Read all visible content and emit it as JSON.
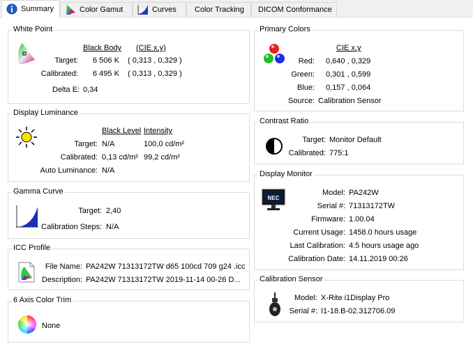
{
  "tabs": [
    {
      "label": "Summary",
      "icon": "info-icon",
      "active": true
    },
    {
      "label": "Color Gamut",
      "icon": "color-gamut-icon",
      "active": false
    },
    {
      "label": "Curves",
      "icon": "curves-icon",
      "active": false
    },
    {
      "label": "Color Tracking",
      "icon": "",
      "active": false
    },
    {
      "label": "DICOM Conformance",
      "icon": "",
      "active": false
    }
  ],
  "white_point": {
    "title": "White Point",
    "col_black_body": "Black Body",
    "col_cie": "(CIE x,y)",
    "target_label": "Target:",
    "target_bb": "6 506 K",
    "target_cie": "( 0,313 , 0,329 )",
    "calibrated_label": "Calibrated:",
    "calibrated_bb": "6 495 K",
    "calibrated_cie": "( 0,313 , 0,329 )",
    "delta_label": "Delta E:",
    "delta_value": "0,34"
  },
  "display_luminance": {
    "title": "Display Luminance",
    "col_black": "Black Level",
    "col_intensity": "Intensity",
    "target_label": "Target:",
    "target_black": "N/A",
    "target_intensity": "100,0 cd/m²",
    "calibrated_label": "Calibrated:",
    "calibrated_black": "0,13 cd/m²",
    "calibrated_intensity": "99,2 cd/m²",
    "auto_label": "Auto Luminance:",
    "auto_value": "N/A"
  },
  "gamma_curve": {
    "title": "Gamma Curve",
    "target_label": "Target:",
    "target_value": "2,40",
    "steps_label": "Calibration Steps:",
    "steps_value": "N/A"
  },
  "icc_profile": {
    "title": "ICC Profile",
    "file_label": "File Name:",
    "file_value": "PA242W 71313172TW d65 100cd 709 g24 .icc",
    "desc_label": "Description:",
    "desc_value": "PA242W 71313172TW 2019-11-14 00-26 D..."
  },
  "six_axis": {
    "title": "6 Axis Color Trim",
    "value": "None"
  },
  "primary_colors": {
    "title": "Primary Colors",
    "col_cie": "CIE x,y",
    "red_label": "Red:",
    "red_value": "0,640 , 0,329",
    "green_label": "Green:",
    "green_value": "0,301 , 0,599",
    "blue_label": "Blue:",
    "blue_value": "0,157 , 0,064",
    "source_label": "Source:",
    "source_value": "Calibration Sensor"
  },
  "contrast_ratio": {
    "title": "Contrast Ratio",
    "target_label": "Target:",
    "target_value": "Monitor Default",
    "calibrated_label": "Calibrated:",
    "calibrated_value": "775:1"
  },
  "display_monitor": {
    "title": "Display Monitor",
    "logo_text": "NEC",
    "model_label": "Model:",
    "model_value": "PA242W",
    "serial_label": "Serial #:",
    "serial_value": "71313172TW",
    "firmware_label": "Firmware:",
    "firmware_value": "1.00.04",
    "usage_label": "Current Usage:",
    "usage_value": "1458.0 hours usage",
    "lastcal_label": "Last Calibration:",
    "lastcal_value": "4.5 hours usage ago",
    "caldate_label": "Calibration Date:",
    "caldate_value": "14.11.2019 00:26"
  },
  "calibration_sensor": {
    "title": "Calibration Sensor",
    "model_label": "Model:",
    "model_value": "X-Rite i1Display Pro",
    "serial_label": "Serial #:",
    "serial_value": "I1-18.B-02.312706.09"
  }
}
